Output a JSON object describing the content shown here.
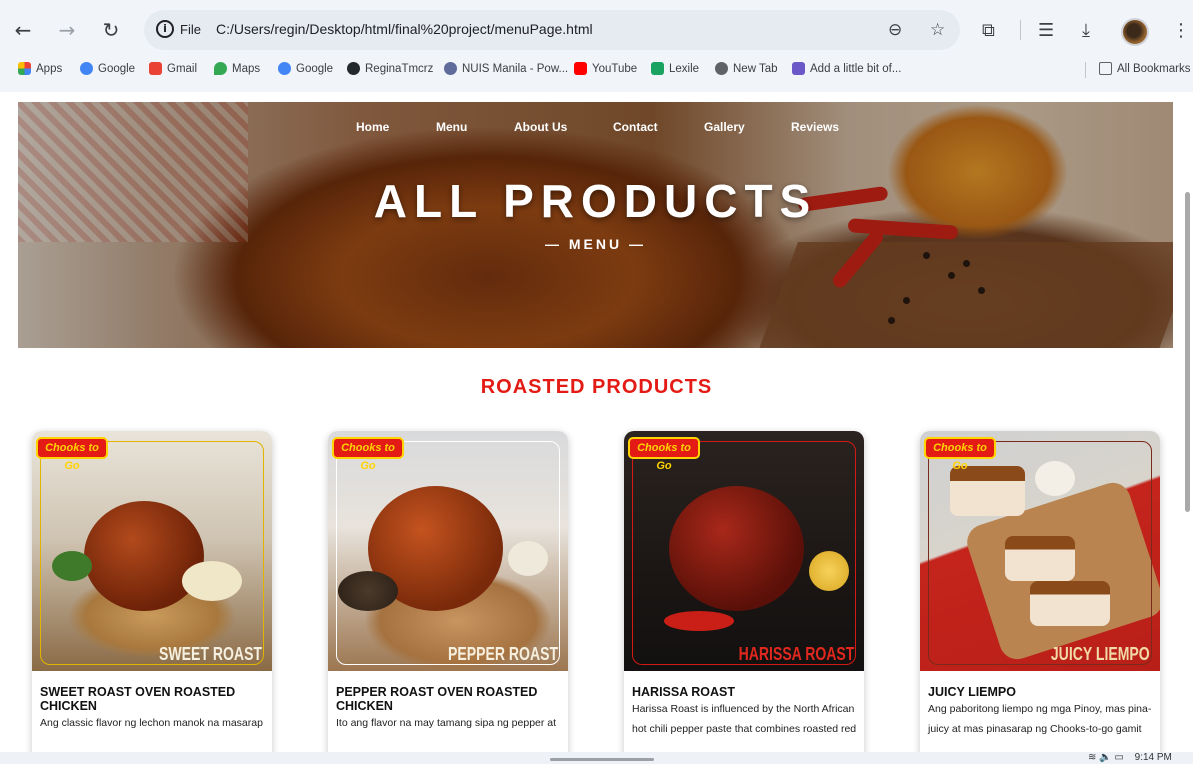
{
  "browser": {
    "tab_file_label": "File",
    "url": "C:/Users/regin/Desktop/html/final%20project/menuPage.html",
    "bookmarks": [
      {
        "label": "Apps",
        "color": "#ea4335"
      },
      {
        "label": "Google",
        "color": "#4285f4"
      },
      {
        "label": "Gmail",
        "color": "#ea4335"
      },
      {
        "label": "Maps",
        "color": "#34a853"
      },
      {
        "label": "Google",
        "color": "#4285f4"
      },
      {
        "label": "ReginaTmcrz",
        "color": "#24292e"
      },
      {
        "label": "NUIS Manila - Pow...",
        "color": "#5f6b9a"
      },
      {
        "label": "YouTube",
        "color": "#ff0000"
      },
      {
        "label": "Lexile",
        "color": "#1aa260"
      },
      {
        "label": "New Tab",
        "color": "#5f6368"
      },
      {
        "label": "Add a little bit of...",
        "color": "#6b57c8"
      }
    ],
    "all_bookmarks_label": "All Bookmarks"
  },
  "nav": {
    "links": [
      "Home",
      "Menu",
      "About Us",
      "Contact",
      "Gallery",
      "Reviews"
    ]
  },
  "hero": {
    "title": "ALL PRODUCTS",
    "subtitle": "— MENU —"
  },
  "section": {
    "title": "ROASTED PRODUCTS"
  },
  "products": [
    {
      "brand": "Chooks to Go",
      "image_label": "SWEET ROAST",
      "name": "SWEET ROAST OVEN ROASTED CHICKEN",
      "desc": "Ang classic flavor ng lechon manok na masarap",
      "frame_color": "#e0b400"
    },
    {
      "brand": "Chooks to Go",
      "image_label": "PEPPER ROAST",
      "name": "PEPPER ROAST OVEN ROASTED CHICKEN",
      "desc": "Ito ang flavor na may tamang sipa ng pepper at",
      "frame_color": "#ffffff"
    },
    {
      "brand": "Chooks to Go",
      "image_label": "HARISSA ROAST",
      "name": "HARISSA ROAST",
      "desc": "Harissa Roast is influenced by the North African hot chili pepper paste that combines roasted red",
      "frame_color": "#d41a14"
    },
    {
      "brand": "Chooks to Go",
      "image_label": "JUICY LIEMPO",
      "name": "JUICY LIEMPO",
      "desc": "Ang paboritong liempo ng mga Pinoy, mas pina-juicy at mas pinasarap ng Chooks-to-go gamit",
      "frame_color": "#7a2a1a"
    }
  ],
  "taskbar": {
    "time": "9:14 PM"
  }
}
